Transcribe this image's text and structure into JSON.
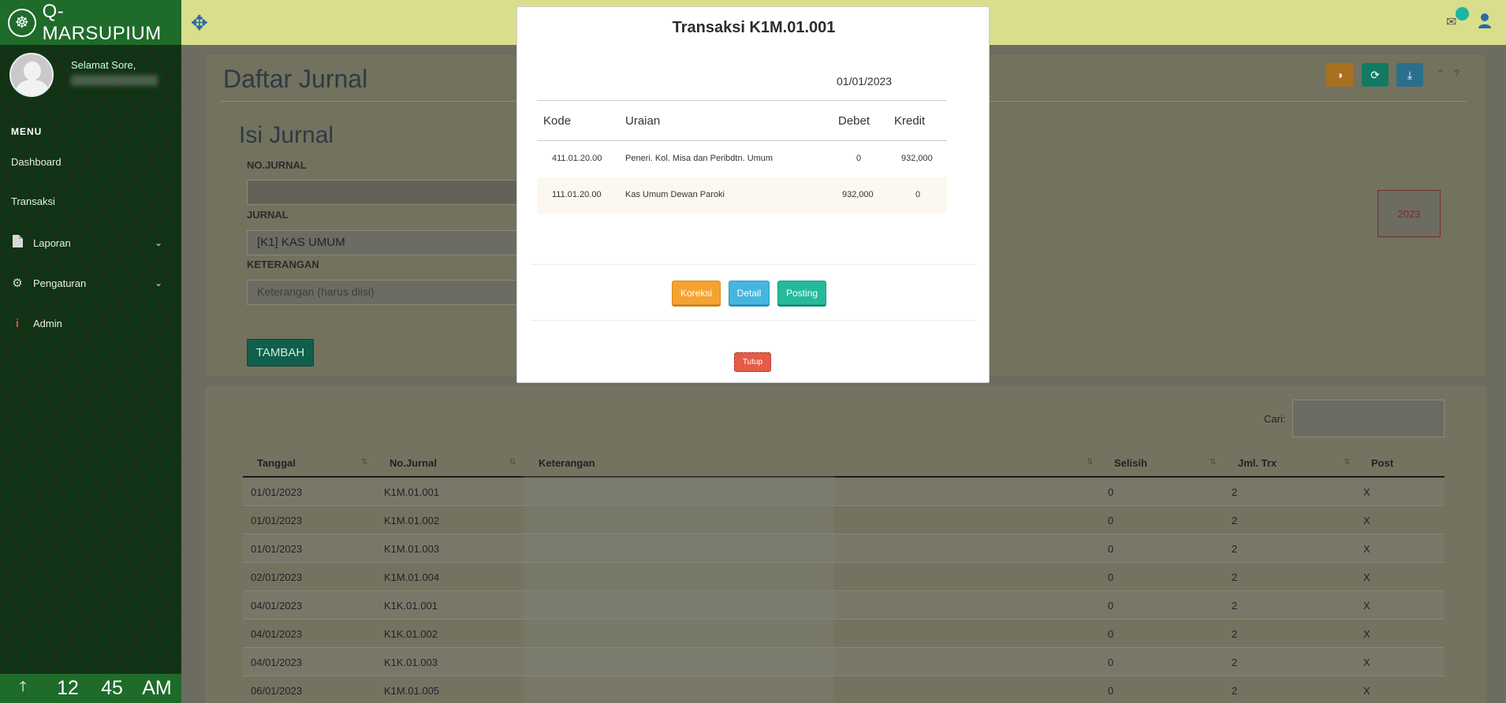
{
  "app": {
    "brand": "Q-MARSUPIUM",
    "greeting": "Selamat Sore,"
  },
  "sidebar": {
    "menu_header": "MENU",
    "items": [
      {
        "label": "Dashboard",
        "icon": ""
      },
      {
        "label": "Transaksi",
        "icon": ""
      },
      {
        "label": "Laporan",
        "icon": "file-icon"
      },
      {
        "label": "Pengaturan",
        "icon": "gear-icon"
      },
      {
        "label": "Admin",
        "icon": "info-icon"
      }
    ]
  },
  "clock": {
    "hour": "12",
    "minute": "45",
    "ampm": "AM"
  },
  "page": {
    "title": "Daftar Jurnal",
    "form_title": "Isi Jurnal",
    "no_jurnal_label": "NO.JURNAL",
    "jurnal_label": "JURNAL",
    "jurnal_value": "[K1] KAS UMUM",
    "keterangan_label": "KETERANGAN",
    "keterangan_placeholder": "Keterangan (harus diisi)",
    "tambah_label": "TAMBAH",
    "year": "2023",
    "search_label": "Cari:"
  },
  "toolbar": {
    "colors": {
      "orange": "#f4a331",
      "teal": "#26b99a",
      "blue": "#44b6e0"
    },
    "help": "?"
  },
  "journal_table": {
    "columns": [
      "Tanggal",
      "No.Jurnal",
      "Keterangan",
      "Selisih",
      "Jml. Trx",
      "Post"
    ],
    "rows": [
      {
        "tanggal": "01/01/2023",
        "no": "K1M.01.001",
        "selisih": "0",
        "jml": "2",
        "post": "X"
      },
      {
        "tanggal": "01/01/2023",
        "no": "K1M.01.002",
        "selisih": "0",
        "jml": "2",
        "post": "X"
      },
      {
        "tanggal": "01/01/2023",
        "no": "K1M.01.003",
        "selisih": "0",
        "jml": "2",
        "post": "X"
      },
      {
        "tanggal": "02/01/2023",
        "no": "K1M.01.004",
        "selisih": "0",
        "jml": "2",
        "post": "X"
      },
      {
        "tanggal": "04/01/2023",
        "no": "K1K.01.001",
        "selisih": "0",
        "jml": "2",
        "post": "X"
      },
      {
        "tanggal": "04/01/2023",
        "no": "K1K.01.002",
        "selisih": "0",
        "jml": "2",
        "post": "X"
      },
      {
        "tanggal": "04/01/2023",
        "no": "K1K.01.003",
        "selisih": "0",
        "jml": "2",
        "post": "X"
      },
      {
        "tanggal": "06/01/2023",
        "no": "K1M.01.005",
        "selisih": "0",
        "jml": "2",
        "post": "X"
      }
    ]
  },
  "modal": {
    "title": "Transaksi K1M.01.001",
    "date": "01/01/2023",
    "columns": [
      "Kode",
      "Uraian",
      "Debet",
      "Kredit"
    ],
    "rows": [
      {
        "kode": "411.01.20.00",
        "uraian": "Peneri. Kol. Misa dan Peribdtn. Umum",
        "debet": "0",
        "kredit": "932,000"
      },
      {
        "kode": "111.01.20.00",
        "uraian": "Kas Umum Dewan Paroki",
        "debet": "932,000",
        "kredit": "0"
      }
    ],
    "buttons": {
      "koreksi": "Koreksi",
      "detail": "Detail",
      "posting": "Posting",
      "tutup": "Tutup"
    }
  }
}
